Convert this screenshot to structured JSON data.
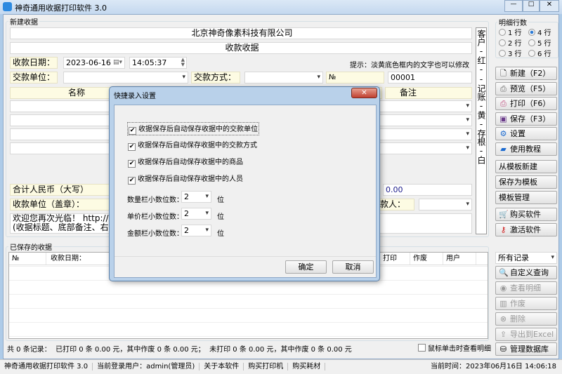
{
  "window": {
    "title": "神奇通用收据打印软件 3.0",
    "controls": [
      "—",
      "□",
      "✕"
    ]
  },
  "form": {
    "group_label": "新建收据",
    "company": "北京神奇像素科技有限公司",
    "receipt_title": "收款收据",
    "date_label": "收款日期：",
    "date": "2023-06-16",
    "time": "14:05:37",
    "hint": "提示：淡黄底色框内的文字也可以修改",
    "payer_label": "交款单位：",
    "payer": "",
    "pay_method_label": "交款方式：",
    "pay_method": "",
    "no_label": "№",
    "no": "00001",
    "col_name": "名称",
    "col_remark": "备注",
    "total_label": "合计人民币（大写）",
    "total_value": "0.00",
    "payee_unit_label": "收款单位（盖章）：",
    "payee_label": "款人：",
    "footer_line1": "欢迎您再次光临！ http://www",
    "footer_line2": "(收据标题、底部备注、右侧",
    "stub": "客户-红--记账-黄-存根-白"
  },
  "rows_setting": {
    "label": "明细行数",
    "options": [
      "1 行",
      "4 行",
      "2 行",
      "5 行",
      "3 行",
      "6 行"
    ],
    "selected": "4 行"
  },
  "side_buttons": [
    "新建（F2）",
    "预览（F5）",
    "打印（F6）",
    "保存（F3）",
    "设置",
    "使用教程",
    "从模板新建",
    "保存为模板",
    "模板管理",
    "购买软件",
    "激活软件"
  ],
  "saved": {
    "group_label": "已保存的收据",
    "columns": [
      "№",
      "收款日期：",
      "打印",
      "作废",
      "用户"
    ],
    "filter": "所有记录",
    "buttons": [
      "自定义查询",
      "查看明细",
      "作废",
      "删除",
      "导出到Excel",
      "管理数据库"
    ],
    "summary": "共 0 条记录：  已打印 0 条 0.00 元，其中作废 0 条 0.00 元；  未打印 0 条 0.00 元，其中作废 0 条 0.00 元",
    "click_detail": "鼠标单击时查看明细"
  },
  "status": {
    "items": [
      "神奇通用收据打印软件 3.0",
      "当前登录用户：admin(管理员)",
      "关于本软件",
      "购买打印机",
      "购买耗材"
    ],
    "time": "当前时间：2023年06月16日 14:06:18"
  },
  "dialog": {
    "title": "快捷录入设置",
    "checks": [
      "收据保存后自动保存收据中的交款单位",
      "收据保存后自动保存收据中的交款方式",
      "收据保存后自动保存收据中的商品",
      "收据保存后自动保存收据中的人员"
    ],
    "decimals": [
      {
        "label": "数量栏小数位数：",
        "value": "2"
      },
      {
        "label": "单价栏小数位数：",
        "value": "2"
      },
      {
        "label": "金额栏小数位数：",
        "value": "2"
      }
    ],
    "unit": "位",
    "ok": "确定",
    "cancel": "取消"
  }
}
